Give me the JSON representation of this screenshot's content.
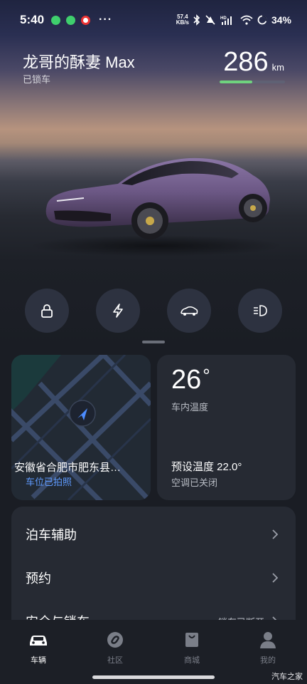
{
  "status_bar": {
    "time": "5:40",
    "more": "···",
    "speed_value": "57.4",
    "speed_unit": "KB/s",
    "battery": "34%"
  },
  "header": {
    "car_name": "龙哥的酥妻 Max",
    "lock_status": "已锁车",
    "range_value": "286",
    "range_unit": "km",
    "range_fill_percent": 50
  },
  "quick_controls": [
    {
      "icon": "lock-icon"
    },
    {
      "icon": "charge-bolt-icon"
    },
    {
      "icon": "trunk-icon"
    },
    {
      "icon": "headlight-icon"
    }
  ],
  "map_card": {
    "address": "安徽省合肥市肥东县…",
    "photo_status": "车位已拍照"
  },
  "temp_card": {
    "temperature": "26",
    "degree": "°",
    "label": "车内温度",
    "preset": "预设温度 22.0°",
    "ac_status": "空调已关闭"
  },
  "list": {
    "parking_assist": "泊车辅助",
    "reservation": "预约",
    "security": "安全与锁车",
    "security_status": "锁车已断开"
  },
  "nav": {
    "vehicle": "车辆",
    "community": "社区",
    "mall": "商城",
    "me": "我的"
  },
  "watermark": "汽车之家",
  "colors": {
    "accent_blue": "#5f9bff",
    "range_green": "#6fd27e",
    "card_bg": "#262a33"
  }
}
